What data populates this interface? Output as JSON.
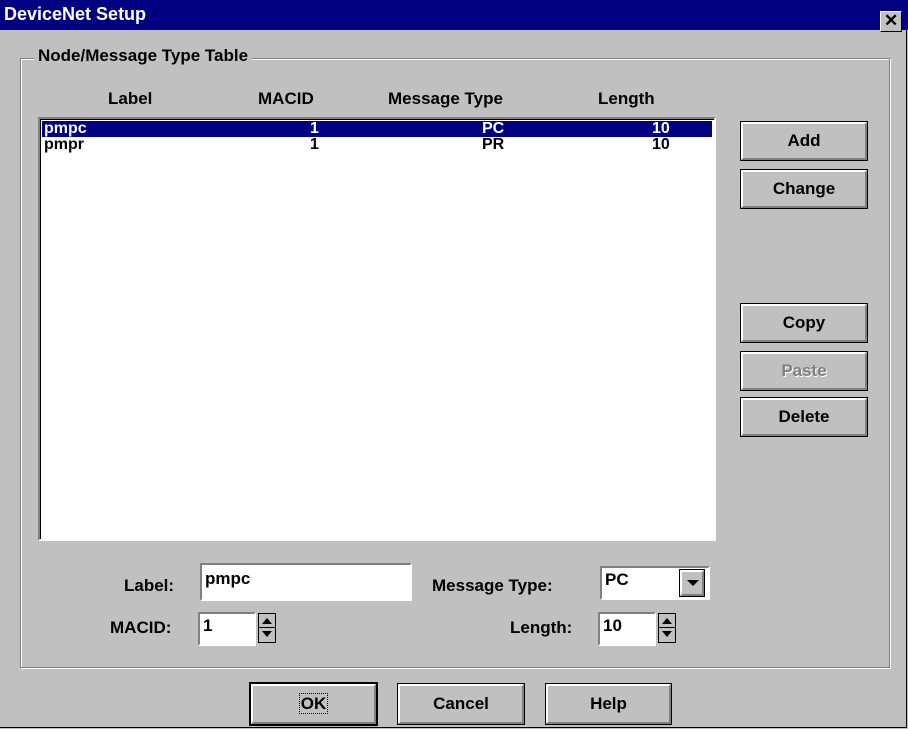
{
  "window": {
    "title": "DeviceNet Setup"
  },
  "group": {
    "title": "Node/Message Type Table"
  },
  "table": {
    "headers": [
      "Label",
      "MACID",
      "Message Type",
      "Length"
    ],
    "rows": [
      {
        "label": "pmpc",
        "macid": "1",
        "type": "PC",
        "length": "10",
        "selected": true
      },
      {
        "label": "pmpr",
        "macid": "1",
        "type": "PR",
        "length": "10",
        "selected": false
      }
    ]
  },
  "side_buttons": {
    "add": "Add",
    "change": "Change",
    "copy": "Copy",
    "paste": "Paste",
    "delete": "Delete"
  },
  "form": {
    "label_caption": "Label:",
    "label_value": "pmpc",
    "macid_caption": "MACID:",
    "macid_value": "1",
    "message_type_caption": "Message Type:",
    "message_type_value": "PC",
    "length_caption": "Length:",
    "length_value": "10"
  },
  "footer": {
    "ok": "OK",
    "cancel": "Cancel",
    "help": "Help"
  },
  "icons": {
    "close": "close-icon",
    "spin": "spin-arrows-icon",
    "dropdown": "chevron-down-icon"
  },
  "colors": {
    "titlebar": "#000080",
    "face": "#c0c0c0",
    "selection": "#000080"
  }
}
